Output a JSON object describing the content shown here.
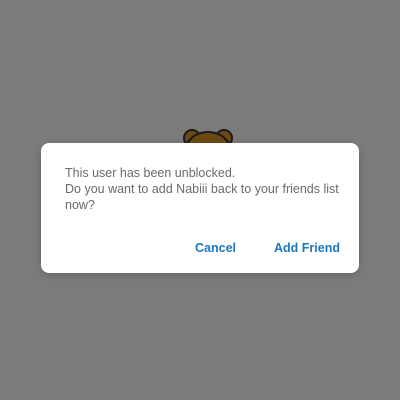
{
  "dialog": {
    "message_line1": "This user has been unblocked.",
    "message_line2": "Do you want to add Nabiii back to your friends list",
    "message_line3": "now?",
    "cancel_label": "Cancel",
    "add_friend_label": "Add Friend"
  },
  "colors": {
    "scrim": "#7a7a7a",
    "dialog_background": "#ffffff",
    "button_text": "#1f76c0",
    "message_text": "#6a6a6a"
  },
  "icons": {
    "background_avatar": "bear-avatar-icon"
  }
}
